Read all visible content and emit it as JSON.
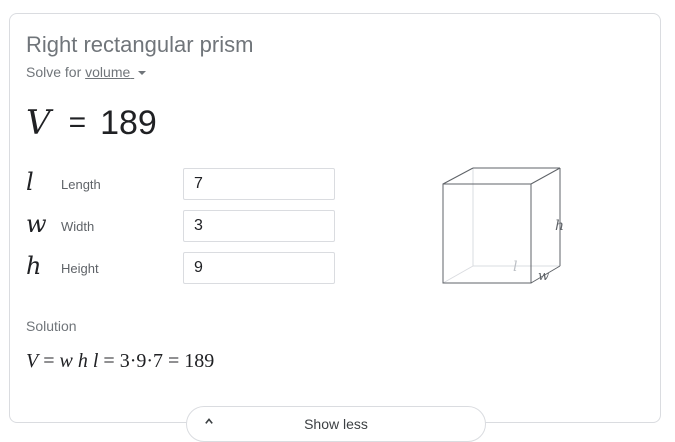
{
  "card": {
    "title": "Right rectangular prism",
    "solve_prefix": "Solve for",
    "solve_target": "volume"
  },
  "result": {
    "variable": "V",
    "equals": "=",
    "value": "189"
  },
  "inputs": [
    {
      "symbol": "l",
      "label": "Length",
      "value": "7"
    },
    {
      "symbol": "w",
      "label": "Width",
      "value": "3"
    },
    {
      "symbol": "h",
      "label": "Height",
      "value": "9"
    }
  ],
  "diagram": {
    "h_label": "h",
    "l_label": "l",
    "w_label": "w",
    "edge_color": "#5f6368",
    "hidden_edge_color": "#dadce0"
  },
  "solution": {
    "label": "Solution",
    "lhs": "V",
    "eq1": "=",
    "vars": [
      "w",
      "h",
      "l"
    ],
    "eq2": "=",
    "expression": "3·9·7",
    "eq3": "=",
    "result": "189"
  },
  "footer": {
    "show_less_label": "Show less",
    "icon": "chevron-up-icon"
  }
}
